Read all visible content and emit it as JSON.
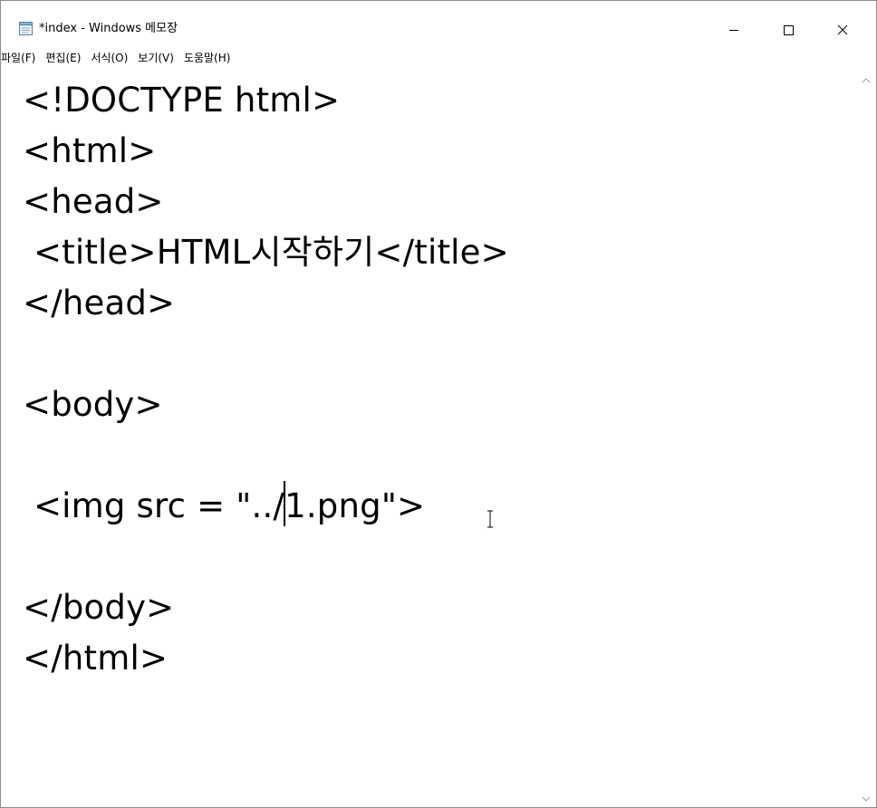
{
  "window": {
    "title": "*index - Windows 메모장"
  },
  "menu": {
    "items": [
      {
        "label": "파일(F)"
      },
      {
        "label": "편집(E)"
      },
      {
        "label": "서식(O)"
      },
      {
        "label": "보기(V)"
      },
      {
        "label": "도움말(H)"
      }
    ]
  },
  "editor": {
    "lines": [
      "<!DOCTYPE html>",
      "<html>",
      "<head>",
      " <title>HTML시작하기</title>",
      "</head>",
      "",
      "<body>",
      "",
      " <img src = \"../1.png\">",
      "",
      "</body>",
      "</html>"
    ],
    "caret_line_before": " <img src = \"../",
    "caret_line_after": "1.png\">"
  },
  "icons": {
    "app": "notepad-icon",
    "minimize": "minimize-icon",
    "maximize": "maximize-icon",
    "close": "close-icon",
    "scroll_up": "chevron-up-icon",
    "scroll_down": "chevron-down-icon",
    "cursor": "text-cursor-icon"
  }
}
